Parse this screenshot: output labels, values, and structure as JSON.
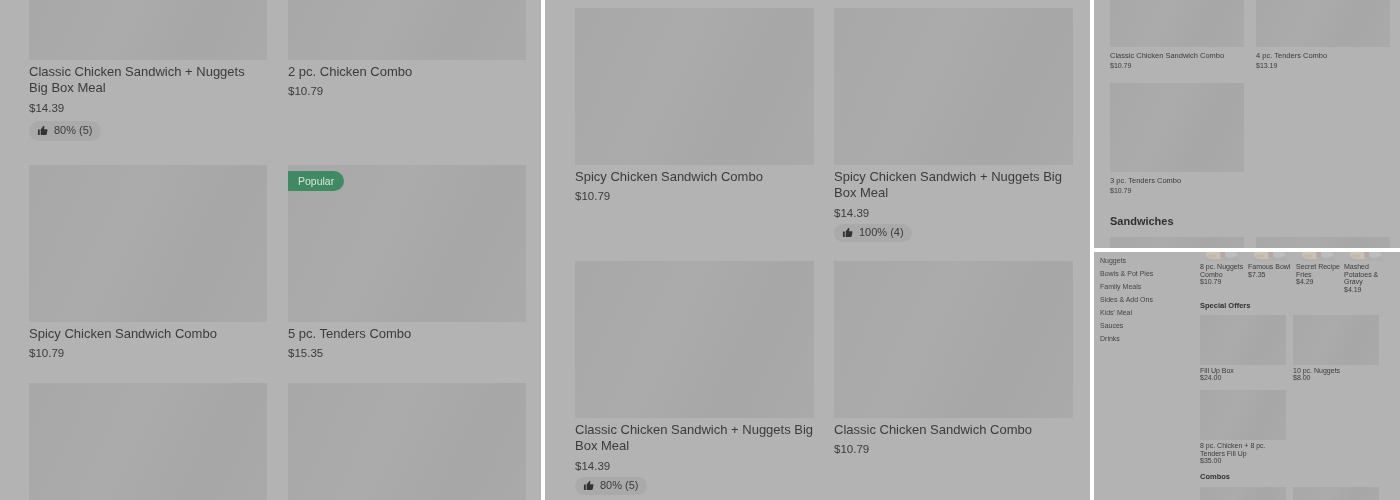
{
  "panels": [
    {
      "kind": "left",
      "sections": [
        {
          "rows": [
            {
              "cards": [
                {
                  "kind": "item",
                  "title": "Classic Chicken Sandwich + Nuggets Big Box Meal",
                  "price": "$14.39",
                  "rating": "80% (5)"
                },
                {
                  "kind": "item",
                  "title": "2 pc. Chicken Combo",
                  "price": "$10.79"
                }
              ]
            },
            {
              "cards": [
                {
                  "kind": "item",
                  "title": "Spicy Chicken Sandwich Combo",
                  "price": "$10.79"
                },
                {
                  "kind": "item",
                  "title": "5 pc. Tenders Combo",
                  "price": "$15.35",
                  "badge": "Popular"
                }
              ]
            },
            {
              "cards": [
                {
                  "kind": "image_only"
                },
                {
                  "kind": "image_only"
                }
              ]
            }
          ]
        }
      ]
    },
    {
      "kind": "middle",
      "sections": [
        {
          "rows": [
            {
              "cards": [
                {
                  "kind": "item",
                  "title": "Spicy Chicken Sandwich Combo",
                  "price": "$10.79"
                },
                {
                  "kind": "item",
                  "title": "Spicy Chicken Sandwich + Nuggets Big Box Meal",
                  "price": "$14.39",
                  "rating": "100% (4)"
                }
              ]
            },
            {
              "cards": [
                {
                  "kind": "item",
                  "title": "Classic Chicken Sandwich + Nuggets Big Box Meal",
                  "price": "$14.39",
                  "rating": "80% (5)"
                },
                {
                  "kind": "item",
                  "title": "Classic Chicken Sandwich Combo",
                  "price": "$10.79"
                }
              ]
            }
          ]
        }
      ]
    },
    {
      "kind": "right_top",
      "sections": [
        {
          "rows": [
            {
              "cards": [
                {
                  "kind": "item",
                  "title": "Classic Chicken Sandwich Combo",
                  "price": "$10.79"
                },
                {
                  "kind": "item",
                  "title": "4 pc. Tenders Combo",
                  "price": "$13.19"
                }
              ]
            },
            {
              "cards": [
                {
                  "kind": "item",
                  "title": "3 pc. Tenders Combo",
                  "price": "$10.79"
                }
              ]
            }
          ]
        },
        {
          "heading": "Sandwiches",
          "rows": [
            {
              "cards": [
                {
                  "kind": "image_only"
                },
                {
                  "kind": "image_only"
                }
              ]
            }
          ]
        }
      ]
    },
    {
      "kind": "right_bottom",
      "categories": [
        "Nuggets",
        "Bowls & Pot Pies",
        "Family Meals",
        "Sides & Add Ons",
        "Kids' Meal",
        "Sauces",
        "Drinks"
      ],
      "sections": [
        {
          "rows": [
            {
              "cards": [
                {
                  "kind": "photo_item",
                  "title": "8 pc. Nuggets Combo",
                  "price": "$10.79"
                },
                {
                  "kind": "photo_item",
                  "title": "Famous Bowl",
                  "price": "$7.35"
                },
                {
                  "kind": "photo_item",
                  "title": "Secret Recipe Fries",
                  "price": "$4.29"
                },
                {
                  "kind": "photo_item",
                  "title": "Mashed Potatoes & Gravy",
                  "price": "$4.19"
                }
              ]
            }
          ]
        },
        {
          "heading": "Special Offers",
          "rows": [
            {
              "cards": [
                {
                  "kind": "item",
                  "title": "Fill Up Box",
                  "price": "$24.00"
                },
                {
                  "kind": "item",
                  "title": "10 pc. Nuggets",
                  "price": "$8.00"
                }
              ]
            },
            {
              "cards": [
                {
                  "kind": "item",
                  "title": "8 pc. Chicken + 8 pc. Tenders Fill Up",
                  "price": "$35.00"
                }
              ]
            }
          ]
        },
        {
          "heading": "Combos",
          "rows": [
            {
              "cards": [
                {
                  "kind": "image_only"
                },
                {
                  "kind": "image_only"
                }
              ]
            }
          ]
        }
      ]
    }
  ]
}
